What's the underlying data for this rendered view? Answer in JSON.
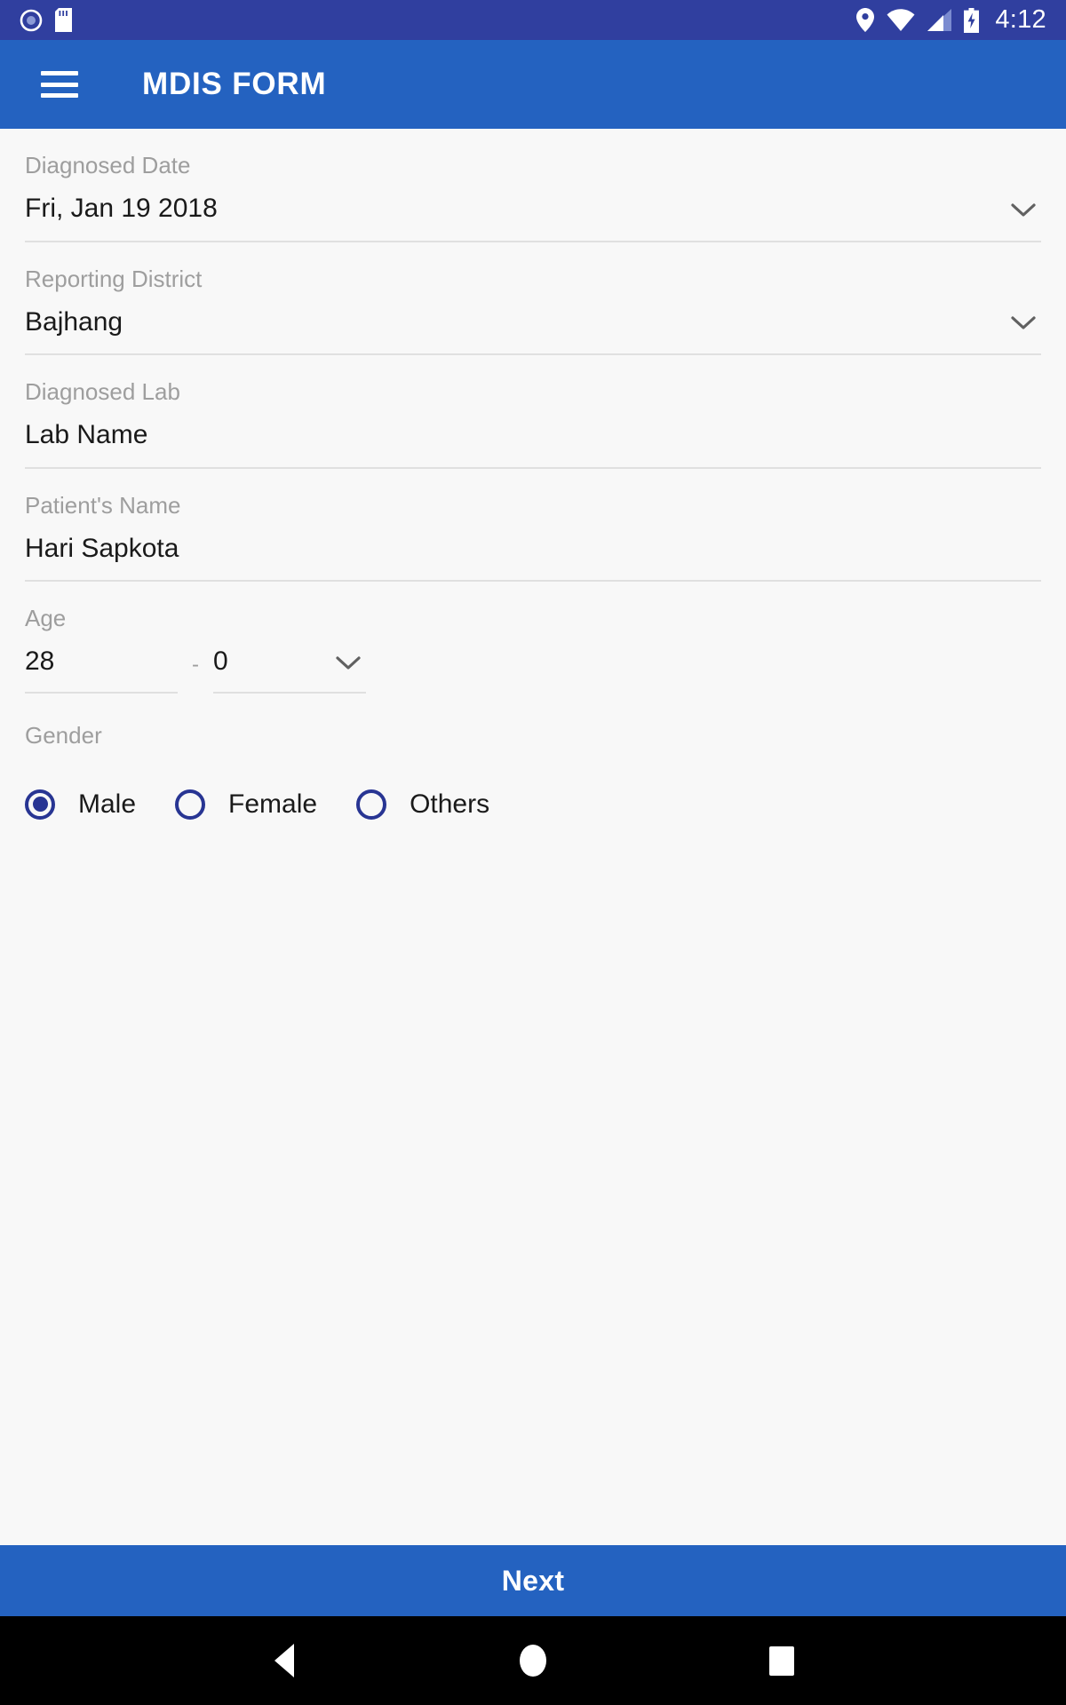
{
  "status_bar": {
    "icons_left": [
      "camera-icon",
      "sd-card-icon"
    ],
    "icons_right": [
      "location-pin-icon",
      "wifi-icon",
      "cell-signal-icon",
      "battery-charging-icon"
    ],
    "time": "4:12",
    "background_color": "#303f9f"
  },
  "app_bar": {
    "menu_icon": "hamburger-menu-icon",
    "title": "MDIS FORM",
    "background_color": "#2462c0"
  },
  "form": {
    "fields": [
      {
        "label": "Diagnosed Date",
        "value": "Fri, Jan 19 2018",
        "type": "dropdown"
      },
      {
        "label": "Reporting District",
        "value": "Bajhang",
        "type": "dropdown"
      },
      {
        "label": "Diagnosed Lab",
        "value": "Lab Name",
        "type": "text"
      },
      {
        "label": "Patient's Name",
        "value": "Hari Sapkota",
        "type": "text"
      }
    ],
    "age": {
      "label": "Age",
      "years_value": "28",
      "separator": "-",
      "months_value": "0"
    },
    "gender": {
      "label": "Gender",
      "options": [
        {
          "label": "Male",
          "selected": true
        },
        {
          "label": "Female",
          "selected": false
        },
        {
          "label": "Others",
          "selected": false
        }
      ],
      "accent_color": "#283593"
    }
  },
  "next_button": {
    "label": "Next",
    "background_color": "#2462c0"
  },
  "nav_bar": {
    "back": "back-triangle-icon",
    "home": "home-circle-icon",
    "recents": "recents-square-icon"
  }
}
